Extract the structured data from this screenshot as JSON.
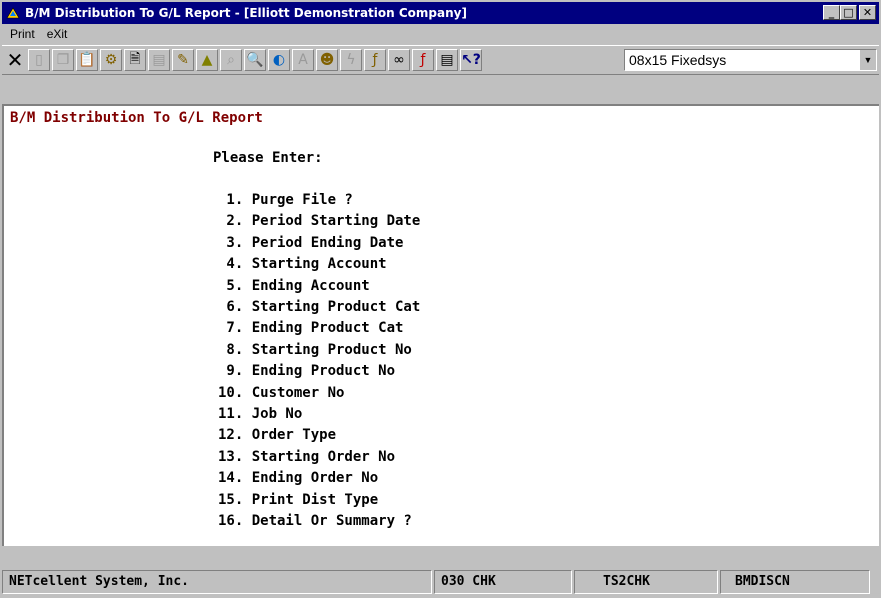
{
  "window": {
    "title": "B/M Distribution To G/L Report - [Elliott Demonstration Company]",
    "icon": "app-icon"
  },
  "menubar": {
    "print_label": "Print",
    "exit_label": "eXit"
  },
  "toolbar": {
    "font_select_value": "08x15 Fixedsys"
  },
  "screen": {
    "report_title": "B/M Distribution To G/L Report",
    "please_enter": "Please Enter:",
    "prompts": [
      " 1. Purge File ?",
      " 2. Period Starting Date",
      " 3. Period Ending Date",
      " 4. Starting Account",
      " 5. Ending Account",
      " 6. Starting Product Cat",
      " 7. Ending Product Cat",
      " 8. Starting Product No",
      " 9. Ending Product No",
      "10. Customer No",
      "11. Job No",
      "12. Order Type",
      "13. Starting Order No",
      "14. Ending Order No",
      "15. Print Dist Type",
      "16. Detail Or Summary ?"
    ]
  },
  "statusbar": {
    "company": "NETcellent System, Inc.",
    "code": "030 CHK",
    "terminal": "TS2CHK",
    "program": "BMDISCN"
  },
  "colors": {
    "titlebar": "#000080",
    "report_title": "#800000",
    "chrome": "#c0c0c0"
  }
}
